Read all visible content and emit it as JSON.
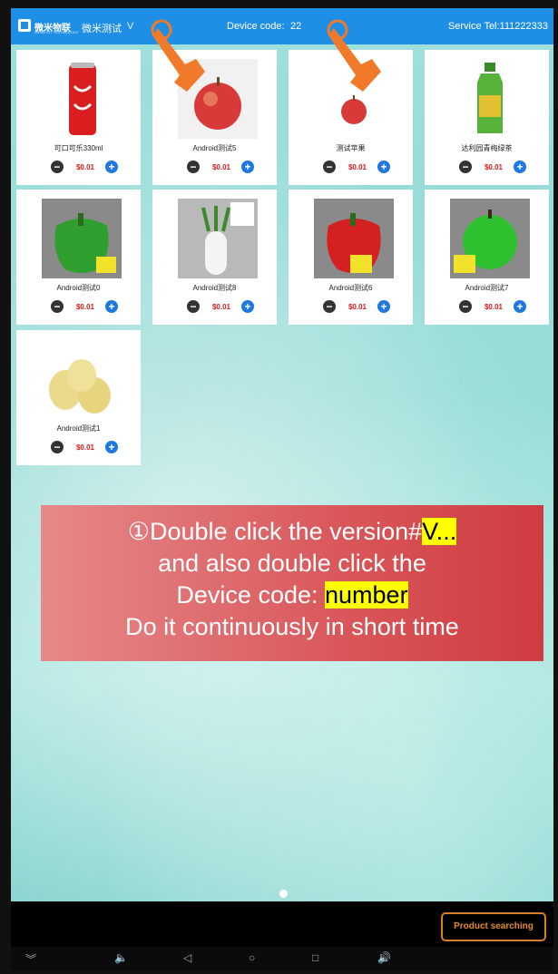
{
  "header": {
    "brand": "微米物联",
    "brand_sub": "WEIMI IOT TECHNOLOGY",
    "app_name": "微米测试",
    "version": "V",
    "device_label": "Device code:",
    "device_number": "22",
    "service": "Service Tel:111222333"
  },
  "products": [
    {
      "name": "可口可乐330ml",
      "price": "$0.01",
      "icon": "cola-can"
    },
    {
      "name": "Android测试5",
      "price": "$0.01",
      "icon": "apple"
    },
    {
      "name": "测试苹果",
      "price": "$0.01",
      "icon": "apple"
    },
    {
      "name": "达利园青梅绿茶",
      "price": "$0.01",
      "icon": "tea-bottle"
    },
    {
      "name": "Android测试0",
      "price": "$0.01",
      "icon": "green-pepper"
    },
    {
      "name": "Android测试8",
      "price": "$0.01",
      "icon": "radish"
    },
    {
      "name": "Android测试6",
      "price": "$0.01",
      "icon": "red-pepper"
    },
    {
      "name": "Android测试7",
      "price": "$0.01",
      "icon": "green-apple"
    },
    {
      "name": "Android测试1",
      "price": "$0.01",
      "icon": "pears"
    }
  ],
  "overlay": {
    "line1_a": "①Double click the version#",
    "line1_b": "V...",
    "line2": "and also double click the",
    "line3_a": "Device code: ",
    "line3_b": "number",
    "line4": "Do it continuously in short time"
  },
  "search_button": "Product searching",
  "colors": {
    "header": "#1f8fe6",
    "price": "#d91a1a",
    "plus": "#1f78e0",
    "overlay": "#d9575a",
    "highlight": "#ffff00",
    "search_border": "#d97f2a"
  }
}
